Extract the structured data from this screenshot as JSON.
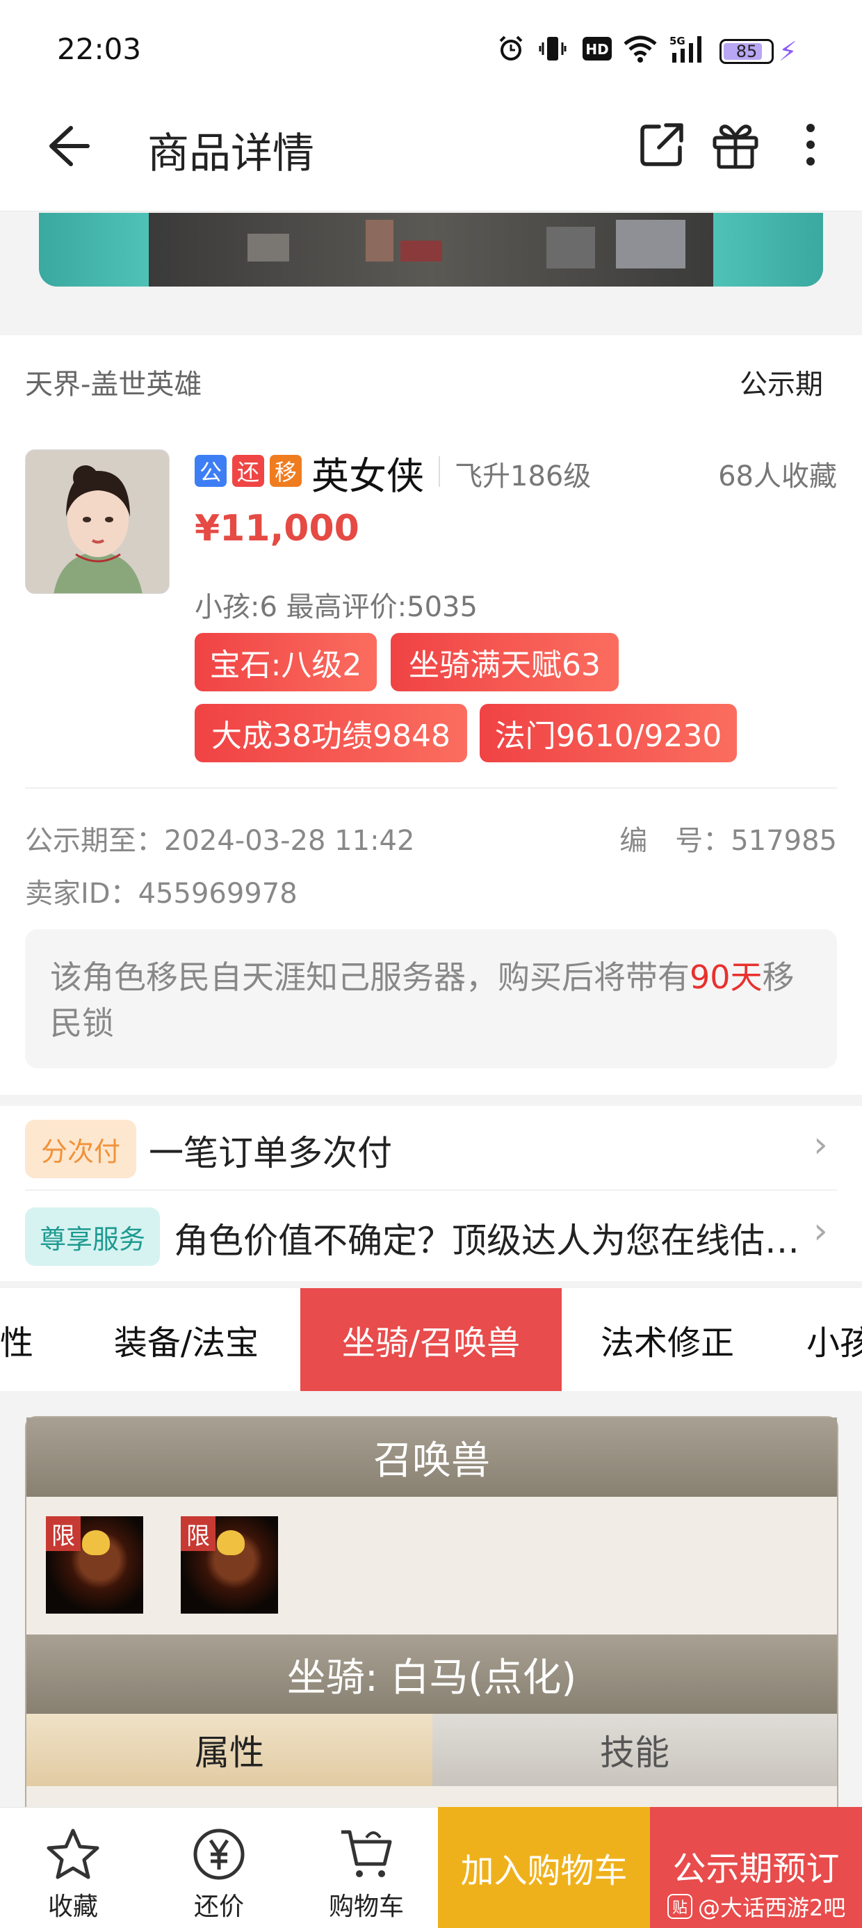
{
  "status_bar": {
    "time": "22:03",
    "battery": "85",
    "battery_level_pct": 85,
    "network": "5G"
  },
  "header": {
    "title": "商品详情"
  },
  "listing": {
    "server": "天界-盖世英雄",
    "status": "公示期",
    "tags": [
      {
        "text": "公",
        "color": "#3d7ef5"
      },
      {
        "text": "还",
        "color": "#f04545"
      },
      {
        "text": "移",
        "color": "#f07c20"
      }
    ],
    "name": "英女侠",
    "level": "飞升186级",
    "favorites": "68人收藏",
    "price": "¥11,000",
    "stats": "小孩:6 最高评价:5035",
    "highlights": [
      "宝石:八级2",
      "坐骑满天赋63",
      "大成38功绩9848",
      "法门9610/9230"
    ],
    "public_until": "公示期至：2024-03-28 11:42",
    "listing_no": "编　号：517985",
    "seller_id": "卖家ID：455969978",
    "migrate_notice": {
      "before": "该角色移民自天涯知己服务器，购买后将带有",
      "highlight": "90天",
      "after": "移民锁"
    }
  },
  "promos": [
    {
      "badge": "分次付",
      "text": "一笔订单多次付"
    },
    {
      "badge": "尊享服务",
      "text": "角色价值不确定？顶级达人为您在线估…"
    }
  ],
  "tabs": [
    "性",
    "装备/法宝",
    "坐骑/召唤兽",
    "法术修正",
    "小孩"
  ],
  "active_tab": "坐骑/召唤兽",
  "panel": {
    "pets_title": "召唤兽",
    "pet_limit_label": "限",
    "mount_title": "坐骑: 白马(点化)",
    "subtab_attr": "属性",
    "subtab_skill": "技能"
  },
  "bottom_bar": {
    "favorite": "收藏",
    "bargain": "还价",
    "cart": "购物车",
    "add_to_cart": "加入购物车",
    "reserve": "公示期预订"
  },
  "watermark": {
    "badge": "贴",
    "text": "@大话西游2吧"
  },
  "colors": {
    "accent": "#e84c4c",
    "price": "#e54a44",
    "cart_button": "#efb11b"
  }
}
